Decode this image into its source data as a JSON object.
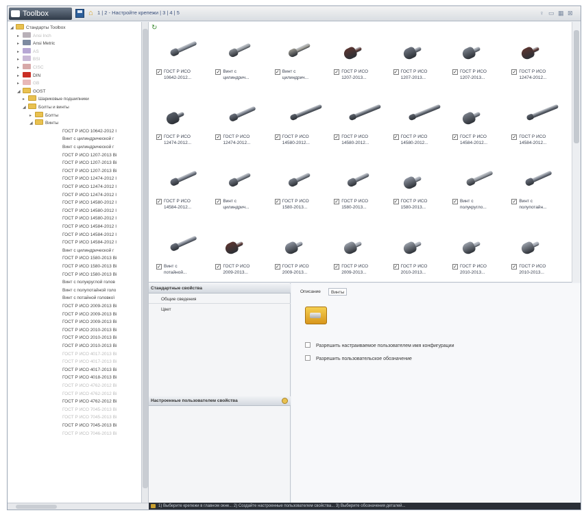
{
  "title": {
    "app_name": "Toolbox",
    "steps": "1 | 2 - Настройте крепежи | 3 | 4 | 5",
    "controls": [
      "pin-icon",
      "restore-icon",
      "grid-icon",
      "close-icon"
    ]
  },
  "tree": {
    "root": "Стандарты Toolbox",
    "standards": [
      {
        "label": "Ansi Inch",
        "dim": true,
        "color": "#b8b0b8"
      },
      {
        "label": "Ansi Metric",
        "dim": false,
        "color": "#7d8aa0"
      },
      {
        "label": "AS",
        "dim": true,
        "color": "#b7a7d4"
      },
      {
        "label": "BSI",
        "dim": true,
        "color": "#c9b8d6"
      },
      {
        "label": "CISC",
        "dim": true,
        "color": "#d7a8a8"
      },
      {
        "label": "DIN",
        "dim": false,
        "color": "#c92e24"
      },
      {
        "label": "GB",
        "dim": true,
        "color": "#e8b8b8"
      },
      {
        "label": "GOST",
        "dim": false,
        "color": "#e9c150"
      }
    ],
    "gost_children": [
      "Шариковые подшипники",
      "Болты и винты"
    ],
    "bolts_children": [
      "Болты",
      "Винты"
    ],
    "items": [
      {
        "label": "ГОСТ Р ИСО 10642-2012 I",
        "dim": false
      },
      {
        "label": "Винт с цилиндрической г",
        "dim": false
      },
      {
        "label": "Винт с цилиндрической г",
        "dim": false
      },
      {
        "label": "ГОСТ Р ИСО 1207-2013 Ві",
        "dim": false
      },
      {
        "label": "ГОСТ Р ИСО 1207-2013 Ві",
        "dim": false
      },
      {
        "label": "ГОСТ Р ИСО 1207-2013 Ві",
        "dim": false
      },
      {
        "label": "ГОСТ Р ИСО 12474-2012 I",
        "dim": false
      },
      {
        "label": "ГОСТ Р ИСО 12474-2012 I",
        "dim": false
      },
      {
        "label": "ГОСТ Р ИСО 12474-2012 I",
        "dim": false
      },
      {
        "label": "ГОСТ Р ИСО 14580-2012 I",
        "dim": false
      },
      {
        "label": "ГОСТ Р ИСО 14580-2012 I",
        "dim": false
      },
      {
        "label": "ГОСТ Р ИСО 14580-2012 I",
        "dim": false
      },
      {
        "label": "ГОСТ Р ИСО 14584-2012 I",
        "dim": false
      },
      {
        "label": "ГОСТ Р ИСО 14584-2012 I",
        "dim": false
      },
      {
        "label": "ГОСТ Р ИСО 14584-2012 I",
        "dim": false
      },
      {
        "label": "Винт с цилиндрической г",
        "dim": false
      },
      {
        "label": "ГОСТ Р ИСО 1580-2013 Ві",
        "dim": false
      },
      {
        "label": "ГОСТ Р ИСО 1580-2013 Ві",
        "dim": false
      },
      {
        "label": "ГОСТ Р ИСО 1580-2013 Ві",
        "dim": false
      },
      {
        "label": "Винт с полукруглой голов",
        "dim": false
      },
      {
        "label": "Винт с полупотайной голо",
        "dim": false
      },
      {
        "label": "Винт с потайной головкої",
        "dim": false
      },
      {
        "label": "ГОСТ Р ИСО 2009-2013 Ві",
        "dim": false
      },
      {
        "label": "ГОСТ Р ИСО 2009-2013 Ві",
        "dim": false
      },
      {
        "label": "ГОСТ Р ИСО 2009-2013 Ві",
        "dim": false
      },
      {
        "label": "ГОСТ Р ИСО 2010-2013 Ві",
        "dim": false
      },
      {
        "label": "ГОСТ Р ИСО 2010-2013 Ві",
        "dim": false
      },
      {
        "label": "ГОСТ Р ИСО 2010-2013 Ві",
        "dim": false
      },
      {
        "label": "ГОСТ Р ИСО 4017-2013 Ві",
        "dim": true
      },
      {
        "label": "ГОСТ Р ИСО 4017-2013 Ві",
        "dim": true
      },
      {
        "label": "ГОСТ Р ИСО 4017-2013 Ві",
        "dim": false
      },
      {
        "label": "ГОСТ Р ИСО 4018-2013 Ві",
        "dim": false
      },
      {
        "label": "ГОСТ Р ИСО 4762-2012 Ві",
        "dim": true
      },
      {
        "label": "ГОСТ Р ИСО 4762-2012 Ві",
        "dim": true
      },
      {
        "label": "ГОСТ Р ИСО 4762-2012 Ві",
        "dim": false
      },
      {
        "label": "ГОСТ Р ИСО 7045-2013 Ві",
        "dim": true
      },
      {
        "label": "ГОСТ Р ИСО 7045-2013 Ві",
        "dim": true
      },
      {
        "label": "ГОСТ Р ИСО 7045-2013 Ві",
        "dim": false
      },
      {
        "label": "ГОСТ Р ИСО 7046-2013 Ві",
        "dim": true
      }
    ]
  },
  "grid": {
    "checked_mark": "✓",
    "cells": [
      {
        "line1": "ГОСТ Р ИСО",
        "line2": "10642-2012...",
        "bolt": "long",
        "color": "#7e8590"
      },
      {
        "line1": "Винт с",
        "line2": "цилиндрич...",
        "bolt": "short",
        "color": "#8d9298"
      },
      {
        "line1": "Винт с",
        "line2": "цилиндрич...",
        "bolt": "short",
        "color": "#9a9890"
      },
      {
        "line1": "ГОСТ Р ИСО",
        "line2": "1207-2013...",
        "bolt": "stub",
        "color": "#5a3530"
      },
      {
        "line1": "ГОСТ Р ИСО",
        "line2": "1207-2013...",
        "bolt": "stub",
        "color": "#6f7580"
      },
      {
        "line1": "ГОСТ Р ИСО",
        "line2": "1207-2013...",
        "bolt": "stub",
        "color": "#7b828c"
      },
      {
        "line1": "ГОСТ Р ИСО",
        "line2": "12474-2012...",
        "bolt": "stub",
        "color": "#5a3530"
      },
      {
        "line1": "ГОСТ Р ИСО",
        "line2": "12474-2012...",
        "bolt": "stub",
        "color": "#5a606a"
      },
      {
        "line1": "ГОСТ Р ИСО",
        "line2": "12474-2012...",
        "bolt": "long",
        "color": "#6e7480"
      },
      {
        "line1": "ГОСТ Р ИСО",
        "line2": "14580-2012...",
        "bolt": "xlong",
        "color": "#5e646e"
      },
      {
        "line1": "ГОСТ Р ИСО",
        "line2": "14580-2012...",
        "bolt": "xlong",
        "color": "#5e646e"
      },
      {
        "line1": "ГОСТ Р ИСО",
        "line2": "14580-2012...",
        "bolt": "xlong",
        "color": "#5e646e"
      },
      {
        "line1": "ГОСТ Р ИСО",
        "line2": "14584-2012...",
        "bolt": "stub",
        "color": "#7a808a"
      },
      {
        "line1": "ГОСТ Р ИСО",
        "line2": "14584-2012...",
        "bolt": "xlong",
        "color": "#5e646e"
      },
      {
        "line1": "ГОСТ Р ИСО",
        "line2": "14584-2012...",
        "bolt": "long",
        "color": "#6e7480"
      },
      {
        "line1": "Винт с",
        "line2": "цилиндрич...",
        "bolt": "short",
        "color": "#7a808a"
      },
      {
        "line1": "ГОСТ Р ИСО",
        "line2": "1580-2013...",
        "bolt": "short",
        "color": "#7a808a"
      },
      {
        "line1": "ГОСТ Р ИСО",
        "line2": "1580-2013...",
        "bolt": "short",
        "color": "#7a808a"
      },
      {
        "line1": "ГОСТ Р ИСО",
        "line2": "1580-2013...",
        "bolt": "stub",
        "color": "#8e94a0"
      },
      {
        "line1": "Винт с",
        "line2": "полукругло...",
        "bolt": "long",
        "color": "#8a8f96"
      },
      {
        "line1": "Винт с",
        "line2": "полупотайн...",
        "bolt": "long",
        "color": "#6e7480"
      },
      {
        "line1": "Винт с",
        "line2": "потайной...",
        "bolt": "long",
        "color": "#6e7480"
      },
      {
        "line1": "ГОСТ Р ИСО",
        "line2": "2009-2013...",
        "bolt": "stub",
        "color": "#5a3530"
      },
      {
        "line1": "ГОСТ Р ИСО",
        "line2": "2009-2013...",
        "bolt": "stub",
        "color": "#8e94a0"
      },
      {
        "line1": "ГОСТ Р ИСО",
        "line2": "2009-2013...",
        "bolt": "stub",
        "color": "#9aa0aa"
      },
      {
        "line1": "ГОСТ Р ИСО",
        "line2": "2010-2013...",
        "bolt": "stub",
        "color": "#9aa0aa"
      },
      {
        "line1": "ГОСТ Р ИСО",
        "line2": "2010-2013...",
        "bolt": "stub",
        "color": "#9aa0aa"
      },
      {
        "line1": "ГОСТ Р ИСО",
        "line2": "2010-2013...",
        "bolt": "stub",
        "color": "#9aa0aa"
      }
    ]
  },
  "std_props": {
    "title": "Стандартные свойства",
    "rows": [
      "Общие сведения",
      "Цвет"
    ]
  },
  "custom_props": {
    "title": "Настроенные пользователем свойства"
  },
  "detail": {
    "tabs": [
      "Описание",
      "Винты"
    ],
    "options": [
      "Разрешить настраиваемое пользователем имя конфигурации",
      "Разрешить пользовательское обозначение"
    ]
  },
  "status": {
    "text": "1) Выберите крепежи в главном окне... 2) Создайте настроенные пользователем свойства... 3) Выберите обозначения деталей..."
  }
}
